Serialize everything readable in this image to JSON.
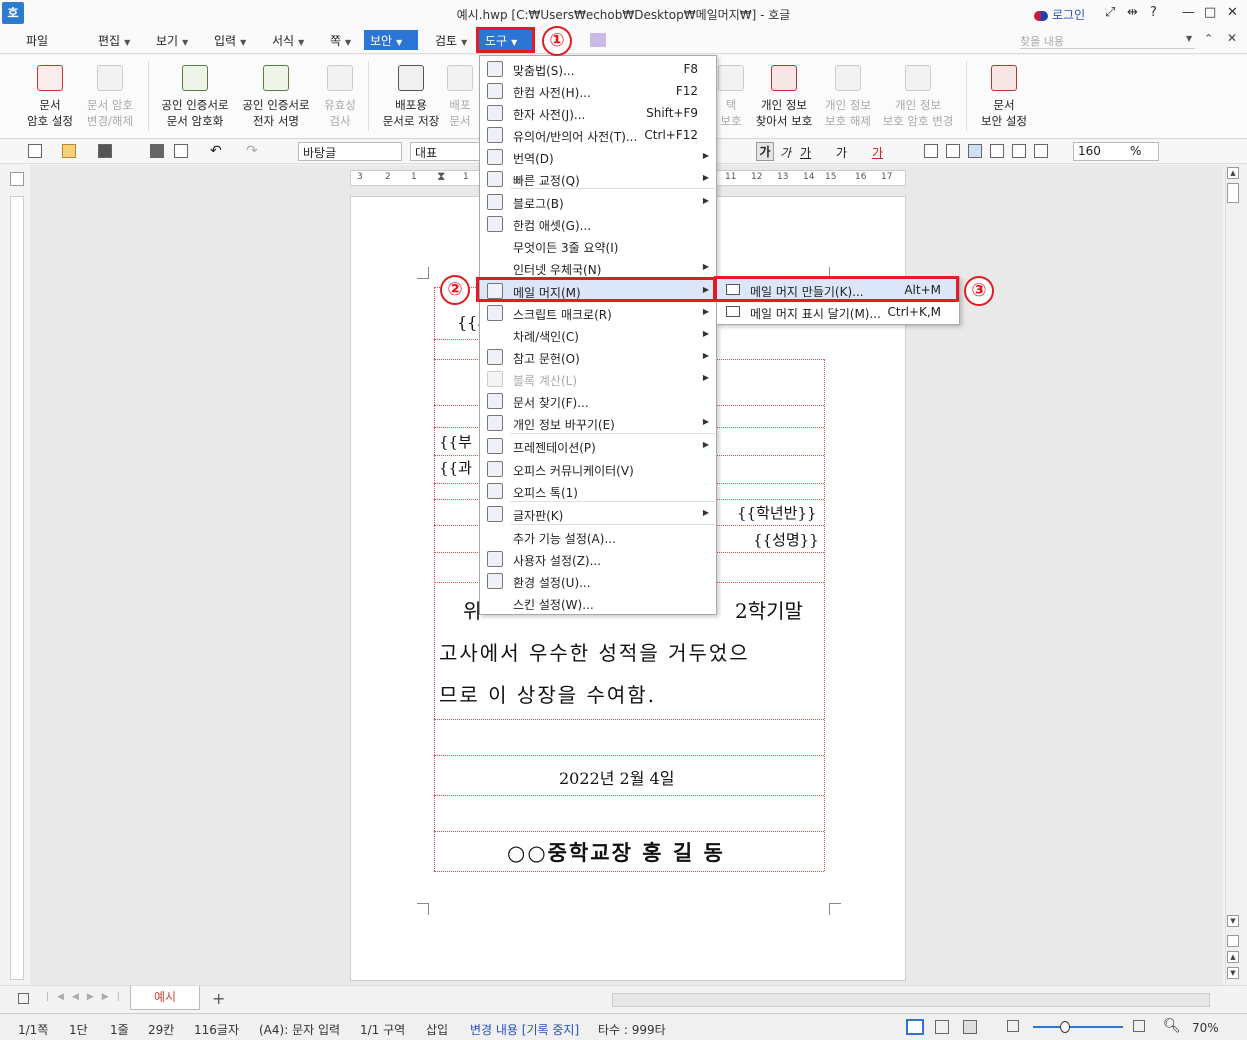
{
  "window": {
    "title": "예시.hwp [C:₩Users₩echob₩Desktop₩메일머지₩] - 호글",
    "app_icon": "호",
    "login": "로그인",
    "controls": [
      "?",
      "—",
      "□",
      "✕"
    ]
  },
  "menubar": {
    "items": [
      "파일",
      "편집",
      "보기",
      "입력",
      "서식",
      "쪽",
      "보안",
      "검토",
      "도구"
    ],
    "search_placeholder": "찾을 내용"
  },
  "ribbon": {
    "buttons": [
      {
        "line1": "문서",
        "line2": "암호 설정",
        "enabled": true
      },
      {
        "line1": "문서 암호",
        "line2": "변경/해제",
        "enabled": false
      },
      {
        "line1": "공인 인증서로",
        "line2": "문서 암호화",
        "enabled": true
      },
      {
        "line1": "공인 인증서로",
        "line2": "전자 서명",
        "enabled": true
      },
      {
        "line1": "유효성",
        "line2": "검사",
        "enabled": false
      },
      {
        "line1": "배포용",
        "line2": "문서로 저장",
        "enabled": true
      },
      {
        "line1": "배포",
        "line2": "문서",
        "enabled": false
      },
      {
        "line1": "택",
        "line2": "보호",
        "enabled": false
      },
      {
        "line1": "개인 정보",
        "line2": "찾아서 보호",
        "enabled": true
      },
      {
        "line1": "개인 정보",
        "line2": "보호 해제",
        "enabled": false
      },
      {
        "line1": "개인 정보",
        "line2": "보호 암호 변경",
        "enabled": false
      },
      {
        "line1": "문서",
        "line2": "보안 설정",
        "enabled": true
      }
    ]
  },
  "toolbar": {
    "style": "바탕글",
    "font": "대표",
    "zoom_value": "160",
    "zoom_unit": "%",
    "format_buttons": [
      "가",
      "가",
      "가",
      "가",
      "가"
    ]
  },
  "ruler": {
    "ticks": [
      "3",
      "2",
      "1",
      "1",
      "1",
      "12",
      "13",
      "14",
      "15",
      "16",
      "17"
    ]
  },
  "document": {
    "field_top": "{{서",
    "field_part": "{{부",
    "field_subject": "{{과",
    "field_grade": "{{학년반}}",
    "field_name": "{{성명}}",
    "body_line1_a": "위",
    "body_line1_b": "2학기말",
    "body_line2": "고사에서 우수한 성적을 거두었으",
    "body_line3": "므로 이 상장을 수여함.",
    "date": "2022년 2월 4일",
    "signature": "○○중학교장 홍 길 동"
  },
  "tools_menu": {
    "items": [
      {
        "label": "맞춤법(S)...",
        "shortcut": "F8",
        "submenu": false,
        "enabled": true,
        "icon": "spellcheck-icon"
      },
      {
        "label": "한컴 사전(H)...",
        "shortcut": "F12",
        "submenu": false,
        "enabled": true,
        "icon": "dictionary-icon"
      },
      {
        "label": "한자 사전(J)...",
        "shortcut": "Shift+F9",
        "submenu": false,
        "enabled": true,
        "icon": "hanja-icon"
      },
      {
        "label": "유의어/반의어 사전(T)...",
        "shortcut": "Ctrl+F12",
        "submenu": false,
        "enabled": true,
        "icon": "thesaurus-icon"
      },
      {
        "label": "번역(D)",
        "shortcut": "",
        "submenu": true,
        "enabled": true,
        "icon": "translate-icon"
      },
      {
        "label": "빠른 교정(Q)",
        "shortcut": "",
        "submenu": true,
        "enabled": true,
        "icon": "quick-correct-icon"
      },
      {
        "label": "블로그(B)",
        "shortcut": "",
        "submenu": true,
        "enabled": true,
        "icon": "blog-icon"
      },
      {
        "label": "한컴 애셋(G)...",
        "shortcut": "",
        "submenu": false,
        "enabled": true,
        "icon": "asset-icon"
      },
      {
        "label": "무엇이든 3줄 요약(I)",
        "shortcut": "",
        "submenu": false,
        "enabled": true,
        "icon": ""
      },
      {
        "label": "인터넷 우체국(N)",
        "shortcut": "",
        "submenu": true,
        "enabled": true,
        "icon": ""
      },
      {
        "label": "메일 머지(M)",
        "shortcut": "",
        "submenu": true,
        "enabled": true,
        "icon": "mail-icon"
      },
      {
        "label": "스크립트 매크로(R)",
        "shortcut": "",
        "submenu": true,
        "enabled": true,
        "icon": "macro-icon"
      },
      {
        "label": "차례/색인(C)",
        "shortcut": "",
        "submenu": true,
        "enabled": true,
        "icon": ""
      },
      {
        "label": "참고 문헌(O)",
        "shortcut": "",
        "submenu": true,
        "enabled": true,
        "icon": "reference-icon"
      },
      {
        "label": "블록 계산(L)",
        "shortcut": "",
        "submenu": true,
        "enabled": false,
        "icon": "calc-icon"
      },
      {
        "label": "문서 찾기(F)...",
        "shortcut": "",
        "submenu": false,
        "enabled": true,
        "icon": "binoculars-icon"
      },
      {
        "label": "개인 정보 바꾸기(E)",
        "shortcut": "",
        "submenu": true,
        "enabled": true,
        "icon": "privacy-icon"
      },
      {
        "label": "프레젠테이션(P)",
        "shortcut": "",
        "submenu": true,
        "enabled": true,
        "icon": "presentation-icon"
      },
      {
        "label": "오피스 커뮤니케이터(V)",
        "shortcut": "",
        "submenu": false,
        "enabled": true,
        "icon": "communicator-icon"
      },
      {
        "label": "오피스 톡(1)",
        "shortcut": "",
        "submenu": false,
        "enabled": true,
        "icon": "talk-icon"
      },
      {
        "label": "글자판(K)",
        "shortcut": "",
        "submenu": true,
        "enabled": true,
        "icon": "keyboard-icon"
      },
      {
        "label": "추가 기능 설정(A)...",
        "shortcut": "",
        "submenu": false,
        "enabled": true,
        "icon": ""
      },
      {
        "label": "사용자 설정(Z)...",
        "shortcut": "",
        "submenu": false,
        "enabled": true,
        "icon": "user-icon"
      },
      {
        "label": "환경 설정(U)...",
        "shortcut": "",
        "submenu": false,
        "enabled": true,
        "icon": "gear-icon"
      },
      {
        "label": "스킨 설정(W)...",
        "shortcut": "",
        "submenu": false,
        "enabled": true,
        "icon": ""
      }
    ]
  },
  "mail_merge_submenu": {
    "items": [
      {
        "label": "메일 머지 만들기(K)...",
        "shortcut": "Alt+M"
      },
      {
        "label": "메일 머지 표시 달기(M)...",
        "shortcut": "Ctrl+K,M"
      }
    ]
  },
  "annotations": [
    "①",
    "②",
    "③"
  ],
  "tabs": {
    "active": "예시",
    "add": "+"
  },
  "statusbar": {
    "page": "1/1쪽",
    "column": "1단",
    "line": "1줄",
    "char_pos": "29칸",
    "char_count": "116글자",
    "mode": "(A4): 문자 입력",
    "section": "1/1 구역",
    "insert": "삽입",
    "track": "변경 내용 [기록 중지]",
    "typing": "타수 : 999타",
    "zoom": "70%"
  },
  "colors": {
    "accent": "#2b75d6",
    "annotation_red": "#e41b23",
    "highlight": "#dbe6f9"
  }
}
